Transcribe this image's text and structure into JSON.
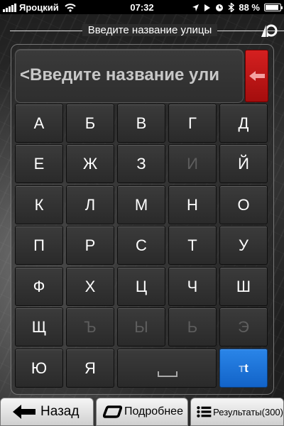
{
  "status_bar": {
    "carrier": "Яроцкий",
    "time": "07:32",
    "battery_text": "88 %",
    "battery_level": 0.88,
    "icons": [
      "signal-icon",
      "wifi-icon",
      "location-icon",
      "play-icon",
      "alarm-icon",
      "bluetooth-icon",
      "battery-icon"
    ]
  },
  "header": {
    "title": "Введите название улицы",
    "right_icon": "compass-icon"
  },
  "search": {
    "value": "<Введите название ули",
    "backspace_icon": "arrow-left-icon"
  },
  "keyboard": {
    "rows": [
      [
        {
          "label": "А",
          "enabled": true
        },
        {
          "label": "Б",
          "enabled": true
        },
        {
          "label": "В",
          "enabled": true
        },
        {
          "label": "Г",
          "enabled": true
        },
        {
          "label": "Д",
          "enabled": true
        }
      ],
      [
        {
          "label": "Е",
          "enabled": true
        },
        {
          "label": "Ж",
          "enabled": true
        },
        {
          "label": "З",
          "enabled": true
        },
        {
          "label": "И",
          "enabled": false
        },
        {
          "label": "Й",
          "enabled": true
        }
      ],
      [
        {
          "label": "К",
          "enabled": true
        },
        {
          "label": "Л",
          "enabled": true
        },
        {
          "label": "М",
          "enabled": true
        },
        {
          "label": "Н",
          "enabled": true
        },
        {
          "label": "О",
          "enabled": true
        }
      ],
      [
        {
          "label": "П",
          "enabled": true
        },
        {
          "label": "Р",
          "enabled": true
        },
        {
          "label": "С",
          "enabled": true
        },
        {
          "label": "Т",
          "enabled": true
        },
        {
          "label": "У",
          "enabled": true
        }
      ],
      [
        {
          "label": "Ф",
          "enabled": true
        },
        {
          "label": "Х",
          "enabled": true
        },
        {
          "label": "Ц",
          "enabled": true
        },
        {
          "label": "Ч",
          "enabled": true
        },
        {
          "label": "Ш",
          "enabled": true
        }
      ],
      [
        {
          "label": "Щ",
          "enabled": true
        },
        {
          "label": "Ъ",
          "enabled": false
        },
        {
          "label": "Ы",
          "enabled": false
        },
        {
          "label": "Ь",
          "enabled": false
        },
        {
          "label": "Э",
          "enabled": false
        }
      ]
    ],
    "last_row": {
      "keys": [
        {
          "label": "Ю",
          "enabled": true
        },
        {
          "label": "Я",
          "enabled": true
        }
      ],
      "space_icon": "space-icon",
      "case_toggle": {
        "big": "T",
        "small": "t"
      }
    }
  },
  "bottom_bar": {
    "back_label": "Назад",
    "more_label": "Подробнее",
    "results_label": "Результаты(300)"
  },
  "colors": {
    "accent_red": "#c41414",
    "accent_blue": "#1f74d8",
    "key_bg": "#303030"
  }
}
